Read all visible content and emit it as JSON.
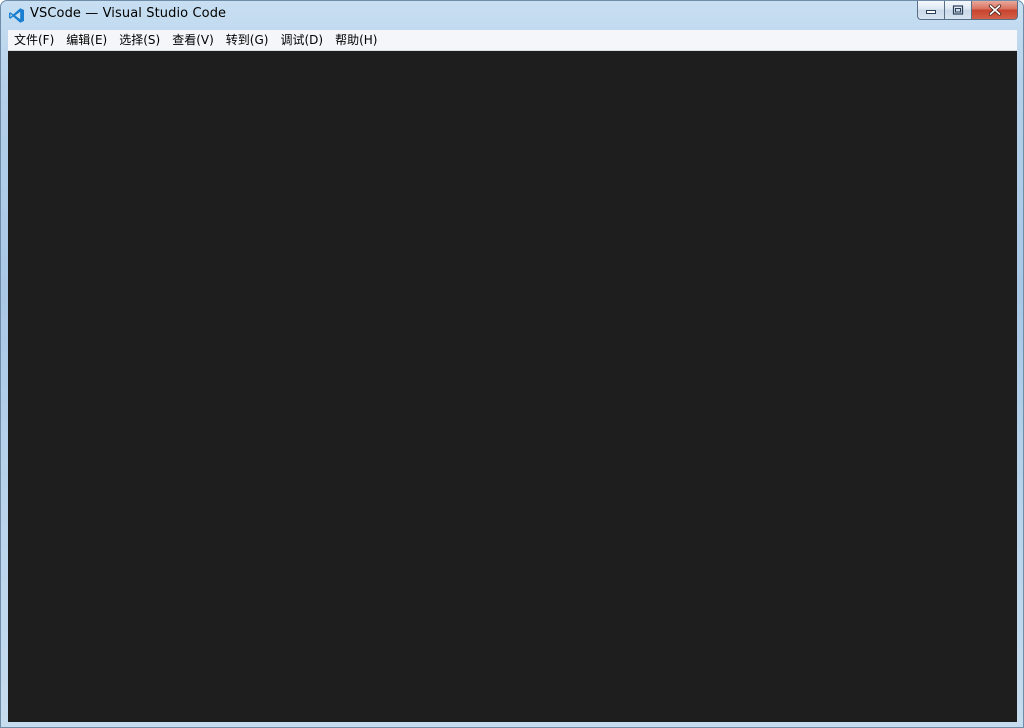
{
  "window": {
    "title": "VSCode — Visual Studio Code",
    "app_icon": "vscode-logo-icon"
  },
  "caption_buttons": {
    "minimize": "minimize-icon",
    "maximize": "maximize-icon",
    "close": "close-icon"
  },
  "menubar": {
    "items": [
      {
        "label": "文件(F)"
      },
      {
        "label": "编辑(E)"
      },
      {
        "label": "选择(S)"
      },
      {
        "label": "查看(V)"
      },
      {
        "label": "转到(G)"
      },
      {
        "label": "调试(D)"
      },
      {
        "label": "帮助(H)"
      }
    ]
  },
  "colors": {
    "editor_background": "#1e1e1e",
    "menubar_background": "#f4f6f9",
    "vscode_blue": "#1a7fd0"
  }
}
